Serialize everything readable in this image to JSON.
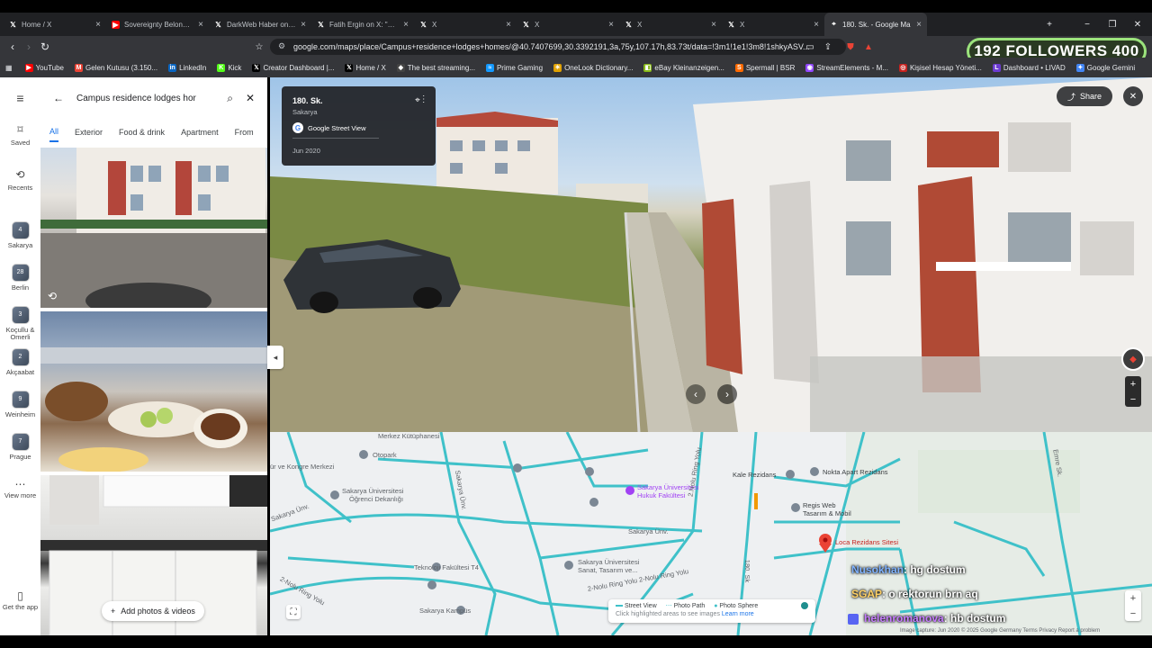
{
  "colors": {
    "accent": "#1a73e8",
    "chrome_dark": "#202124",
    "chrome_mid": "#35363a",
    "road": "#3fc1c9",
    "pin": "#ea4335",
    "followers_border": "#9be37c"
  },
  "tabs": [
    {
      "icon": "x-icon",
      "title": "Home / X"
    },
    {
      "icon": "youtube-icon",
      "title": "Sovereignty Belongs to th"
    },
    {
      "icon": "x-icon",
      "title": "DarkWeb Haber on X: \"A"
    },
    {
      "icon": "x-icon",
      "title": "Fatih Ergin on X: \"SURİYE"
    },
    {
      "icon": "x-icon",
      "title": "X"
    },
    {
      "icon": "x-icon",
      "title": "X"
    },
    {
      "icon": "x-icon",
      "title": "X"
    },
    {
      "icon": "x-icon",
      "title": "X"
    },
    {
      "icon": "maps-icon",
      "title": "180. Sk. - Google Ma"
    }
  ],
  "address": {
    "url": "google.com/maps/place/Campus+residence+lodges+homes/@40.7407699,30.3392191,3a,75y,107.17h,83.73t/data=!3m1!1e1!3m8!1shkyASV..."
  },
  "followers": {
    "count": "192",
    "label": "FOLLOWERS",
    "goal": "400"
  },
  "bookmarks": [
    {
      "icon": "youtube-icon",
      "label": "YouTube"
    },
    {
      "icon": "gmail-icon",
      "label": "Gelen Kutusu (3.150..."
    },
    {
      "icon": "linkedin-icon",
      "label": "LinkedIn"
    },
    {
      "icon": "kick-icon",
      "label": "Kick"
    },
    {
      "icon": "x-icon",
      "label": "Creator Dashboard |..."
    },
    {
      "icon": "x-icon",
      "label": "Home / X"
    },
    {
      "icon": "star-icon",
      "label": "The best streaming..."
    },
    {
      "icon": "prime-icon",
      "label": "Prime Gaming"
    },
    {
      "icon": "dictionary-icon",
      "label": "OneLook Dictionary..."
    },
    {
      "icon": "ebay-icon",
      "label": "eBay Kleinanzeigen..."
    },
    {
      "icon": "bsr-icon",
      "label": "Spermall | BSR"
    },
    {
      "icon": "streamelements-icon",
      "label": "StreamElements - M..."
    },
    {
      "icon": "account-icon",
      "label": "Kişisel Hesap Yöneti..."
    },
    {
      "icon": "livad-icon",
      "label": "Dashboard • LIVAD"
    },
    {
      "icon": "gemini-icon",
      "label": "Google Gemini"
    }
  ],
  "rail": {
    "saved": "Saved",
    "recents": "Recents",
    "places": [
      {
        "badge": "4",
        "label": "Sakarya"
      },
      {
        "badge": "28",
        "label": "Berlin"
      },
      {
        "badge": "3",
        "label": "Koçullu & Omerli"
      },
      {
        "badge": "2",
        "label": "Akçaabat"
      },
      {
        "badge": "9",
        "label": "Weinheim"
      },
      {
        "badge": "7",
        "label": "Prague"
      }
    ],
    "view_more": "View more",
    "get_app": "Get the app"
  },
  "search": {
    "query": "Campus residence lodges hor"
  },
  "chips": [
    "All",
    "Exterior",
    "Food & drink",
    "Apartment",
    "From"
  ],
  "add_photos": "Add photos & videos",
  "streetview": {
    "street": "180. Sk.",
    "city": "Sakarya",
    "source": "Google Street View",
    "date": "Jun 2020",
    "share": "Share"
  },
  "map": {
    "labels": {
      "kutuphane": "Merkez Kütüphanesi",
      "otopark": "Otopark",
      "kongre": "ür ve Kongre Merkezi",
      "ogrenci_1": "Sakarya Üniversitesi",
      "ogrenci_2": "Öğrenci Dekanlığı",
      "sakarya_unv_1": "Sakarya Ünv.",
      "sakarya_unv_2": "Sakarya Ünv.",
      "sakarya_unv_3": "Sakarya Ünv.",
      "hukuk_1": "Sakarya Üniversitesi",
      "hukuk_2": "Hukuk Fakültesi",
      "ringyolu_v": "2.Nolu Ring Yolu",
      "ringyolu_1": "2-Nolu Ring Yolu",
      "ringyolu_2": "2-Nolu Ring Yolu 2-Nolu Ring Yolu",
      "ringyolu_3": "2-Nolu Ring Yolu",
      "teknoloji": "Teknoloji Fakültesi T4",
      "sanat_1": "Sakarya Üniversitesi",
      "sanat_2": "Sanat, Tasarım ve...",
      "kampus": "Sakarya Kampüs",
      "kale": "Kale Rezidans",
      "nokta": "Nokta Apart Rezidans",
      "regis_1": "Regis Web",
      "regis_2": "Tasarım & Mobil",
      "loca": "Loca Rezidans Sitesi",
      "sk180": "180. Sk",
      "emre": "Emre Sk.",
      "attribution": "Image capture: Jun 2020   © 2025 Google   Germany   Terms   Privacy   Report a problem"
    },
    "layers": {
      "sv": "Street View",
      "pp": "Photo Path",
      "ps": "Photo Sphere",
      "hint": "Click highlighted areas to see images",
      "learn": "Learn more"
    }
  },
  "chat": [
    {
      "user": "Nusokhan",
      "msg": ": hg dostum",
      "color": "#7fb2ff"
    },
    {
      "user": "SGAP",
      "msg": ": o rektorun brn aq",
      "color": "#ffd166"
    },
    {
      "user": "helenromanova",
      "msg": ": hb dostum",
      "color": "#c77dff"
    }
  ]
}
